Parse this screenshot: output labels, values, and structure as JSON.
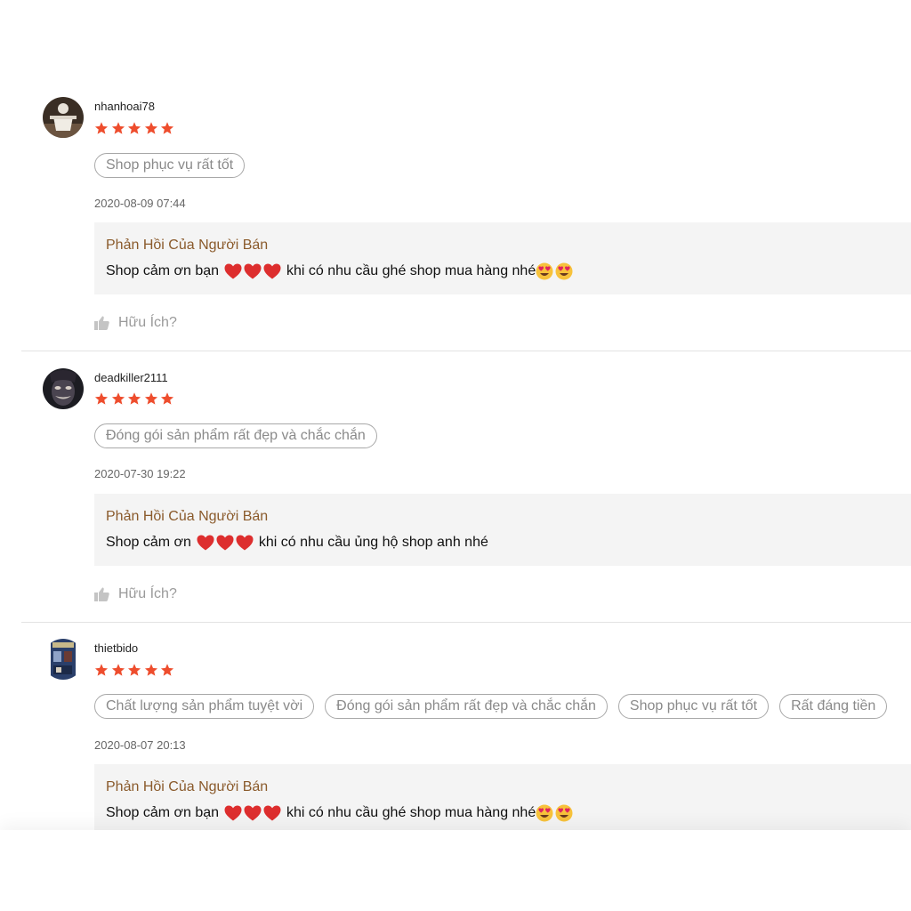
{
  "reviews": [
    {
      "username": "nhanhoai78",
      "rating": 5,
      "tags": [
        "Shop phục vụ rất tốt"
      ],
      "date": "2020-08-09 07:44",
      "reply_title": "Phản Hồi Của Người Bán",
      "reply_text_1": "Shop cảm ơn bạn",
      "reply_text_2": "khi có nhu cầu ghé shop mua hàng nhé",
      "helpful_label": "Hữu Ích?"
    },
    {
      "username": "deadkiller2111",
      "rating": 5,
      "tags": [
        "Đóng gói sản phẩm rất đẹp và chắc chắn"
      ],
      "date": "2020-07-30 19:22",
      "reply_title": "Phản Hồi Của Người Bán",
      "reply_text_1": "Shop cảm ơn",
      "reply_text_2": "khi có nhu cầu ủng hộ shop anh nhé",
      "helpful_label": "Hữu Ích?"
    },
    {
      "username": "thietbido",
      "rating": 5,
      "tags": [
        "Chất lượng sản phẩm tuyệt vời",
        "Đóng gói sản phẩm rất đẹp và chắc chắn",
        "Shop phục vụ rất tốt",
        "Rất đáng tiền"
      ],
      "date": "2020-08-07 20:13",
      "reply_title": "Phản Hồi Của Người Bán",
      "reply_text_1": "Shop cảm ơn bạn",
      "reply_text_2": "khi có nhu cầu ghé shop mua hàng nhé"
    }
  ],
  "colors": {
    "star": "#ee4d2d",
    "reply_title": "#8a5a2b",
    "reply_bg": "#f4f4f4",
    "tag_border": "#a8a8a8"
  },
  "icons": {
    "rating": "star-icon",
    "reply_emoji_1": "red-heart-icon",
    "reply_emoji_2": "heart-eyes-icon",
    "helpful": "thumbs-up-icon"
  }
}
